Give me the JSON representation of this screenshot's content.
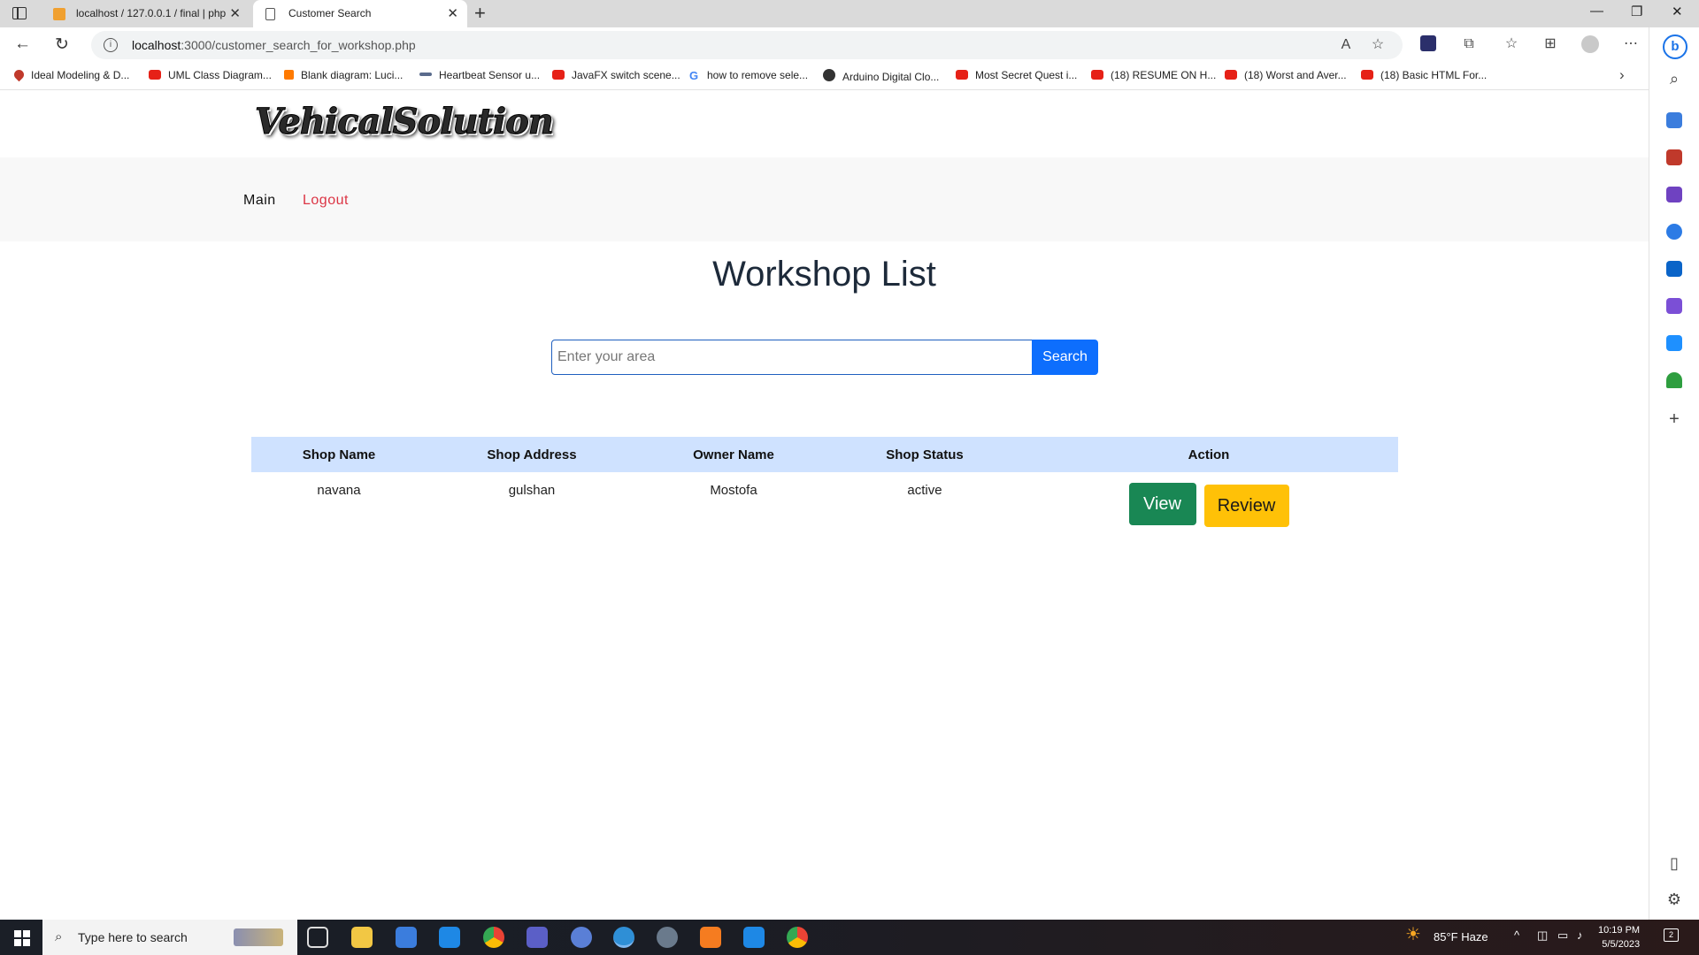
{
  "browser": {
    "tabs": [
      {
        "title": "localhost / 127.0.0.1 / final | php",
        "active": false
      },
      {
        "title": "Customer Search",
        "active": true
      }
    ],
    "url_host": "localhost",
    "url_path": ":3000/customer_search_for_workshop.php",
    "bookmarks": [
      "Ideal Modeling & D...",
      "UML Class Diagram...",
      "Blank diagram: Luci...",
      "Heartbeat Sensor u...",
      "JavaFX switch scene...",
      "how to remove sele...",
      "Arduino Digital Clo...",
      "Most Secret Quest i...",
      "(18) RESUME ON H...",
      "(18) Worst and Aver...",
      "(18) Basic HTML For..."
    ]
  },
  "site": {
    "logo": "VehicalSolution",
    "nav": {
      "main": "Main",
      "logout": "Logout"
    },
    "title": "Workshop List",
    "search": {
      "placeholder": "Enter your area",
      "value": "",
      "button": "Search"
    },
    "table": {
      "headers": [
        "Shop Name",
        "Shop Address",
        "Owner Name",
        "Shop Status",
        "Action"
      ],
      "rows": [
        {
          "shop_name": "navana",
          "shop_address": "gulshan",
          "owner_name": "Mostofa",
          "shop_status": "active",
          "view_label": "View",
          "review_label": "Review"
        }
      ]
    },
    "colors": {
      "nav_band": "#f8f8f8",
      "table_header": "#cfe2ff",
      "search_button": "#0d6efd",
      "view_button": "#198754",
      "review_button": "#ffc107",
      "logout": "#dc3545"
    }
  },
  "taskbar": {
    "search_placeholder": "Type here to search",
    "weather": "85°F  Haze",
    "time": "10:19 PM",
    "date": "5/5/2023",
    "notification_count": "2"
  }
}
